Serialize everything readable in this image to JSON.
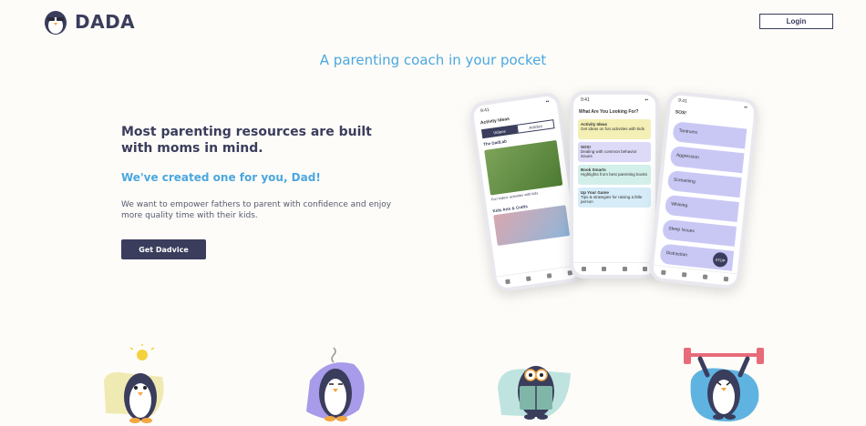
{
  "header": {
    "brand": "DADA",
    "login_label": "Login"
  },
  "hero": {
    "tagline": "A parenting coach in your pocket",
    "headline": "Most parenting resources are built with moms in mind.",
    "subheadline": "We've created one for you, Dad!",
    "description": "We want to empower fathers to parent with confidence and enjoy more quality time with their kids.",
    "cta_label": "Get Dadvice"
  },
  "phone1": {
    "time": "9:41",
    "title": "Activity Ideas",
    "tabs": [
      "Videos",
      "Articles"
    ],
    "card1_title": "The DadLab",
    "card1_caption": "Fun indoor activities with kids",
    "card2_title": "Kids Arts & Crafts"
  },
  "phone2": {
    "time": "9:41",
    "title": "What Are You Looking For?",
    "cards": [
      {
        "title": "Activity Ideas",
        "text": "Get ideas on fun activities with kids",
        "color": "#f3efb5"
      },
      {
        "title": "SOS!",
        "text": "Dealing with common behavior issues",
        "color": "#dcdaf7"
      },
      {
        "title": "Book Smarts",
        "text": "Highlights from best parenting books",
        "color": "#d3efe9"
      },
      {
        "title": "Up Your Game",
        "text": "Tips & strategies for raising a little person",
        "color": "#d6ecf8"
      }
    ]
  },
  "phone3": {
    "time": "9:41",
    "title": "SOS!",
    "items": [
      "Tantrums",
      "Aggression",
      "Screaming",
      "Whining",
      "Sleep Issues",
      "Distraction"
    ],
    "stop_label": "STOP"
  }
}
